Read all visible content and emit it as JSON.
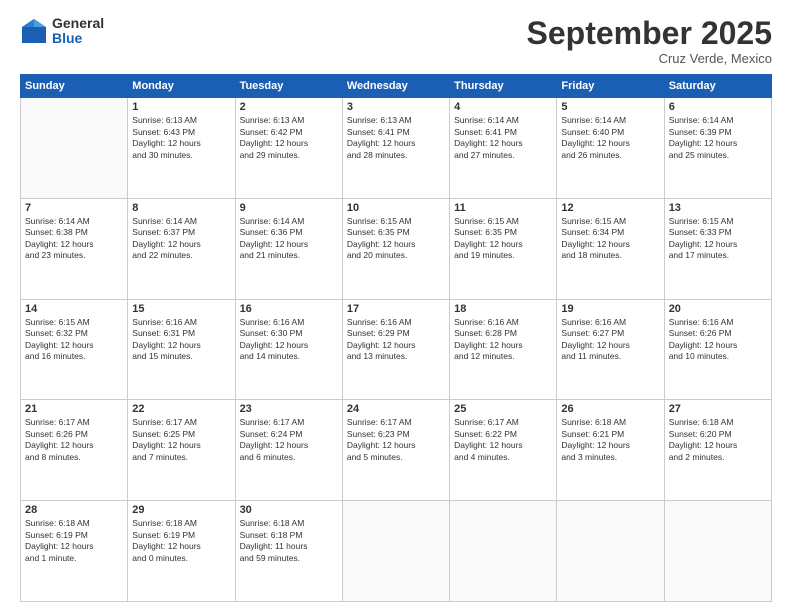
{
  "logo": {
    "general": "General",
    "blue": "Blue"
  },
  "header": {
    "month": "September 2025",
    "location": "Cruz Verde, Mexico"
  },
  "days_of_week": [
    "Sunday",
    "Monday",
    "Tuesday",
    "Wednesday",
    "Thursday",
    "Friday",
    "Saturday"
  ],
  "weeks": [
    [
      {
        "day": "",
        "info": ""
      },
      {
        "day": "1",
        "info": "Sunrise: 6:13 AM\nSunset: 6:43 PM\nDaylight: 12 hours\nand 30 minutes."
      },
      {
        "day": "2",
        "info": "Sunrise: 6:13 AM\nSunset: 6:42 PM\nDaylight: 12 hours\nand 29 minutes."
      },
      {
        "day": "3",
        "info": "Sunrise: 6:13 AM\nSunset: 6:41 PM\nDaylight: 12 hours\nand 28 minutes."
      },
      {
        "day": "4",
        "info": "Sunrise: 6:14 AM\nSunset: 6:41 PM\nDaylight: 12 hours\nand 27 minutes."
      },
      {
        "day": "5",
        "info": "Sunrise: 6:14 AM\nSunset: 6:40 PM\nDaylight: 12 hours\nand 26 minutes."
      },
      {
        "day": "6",
        "info": "Sunrise: 6:14 AM\nSunset: 6:39 PM\nDaylight: 12 hours\nand 25 minutes."
      }
    ],
    [
      {
        "day": "7",
        "info": "Sunrise: 6:14 AM\nSunset: 6:38 PM\nDaylight: 12 hours\nand 23 minutes."
      },
      {
        "day": "8",
        "info": "Sunrise: 6:14 AM\nSunset: 6:37 PM\nDaylight: 12 hours\nand 22 minutes."
      },
      {
        "day": "9",
        "info": "Sunrise: 6:14 AM\nSunset: 6:36 PM\nDaylight: 12 hours\nand 21 minutes."
      },
      {
        "day": "10",
        "info": "Sunrise: 6:15 AM\nSunset: 6:35 PM\nDaylight: 12 hours\nand 20 minutes."
      },
      {
        "day": "11",
        "info": "Sunrise: 6:15 AM\nSunset: 6:35 PM\nDaylight: 12 hours\nand 19 minutes."
      },
      {
        "day": "12",
        "info": "Sunrise: 6:15 AM\nSunset: 6:34 PM\nDaylight: 12 hours\nand 18 minutes."
      },
      {
        "day": "13",
        "info": "Sunrise: 6:15 AM\nSunset: 6:33 PM\nDaylight: 12 hours\nand 17 minutes."
      }
    ],
    [
      {
        "day": "14",
        "info": "Sunrise: 6:15 AM\nSunset: 6:32 PM\nDaylight: 12 hours\nand 16 minutes."
      },
      {
        "day": "15",
        "info": "Sunrise: 6:16 AM\nSunset: 6:31 PM\nDaylight: 12 hours\nand 15 minutes."
      },
      {
        "day": "16",
        "info": "Sunrise: 6:16 AM\nSunset: 6:30 PM\nDaylight: 12 hours\nand 14 minutes."
      },
      {
        "day": "17",
        "info": "Sunrise: 6:16 AM\nSunset: 6:29 PM\nDaylight: 12 hours\nand 13 minutes."
      },
      {
        "day": "18",
        "info": "Sunrise: 6:16 AM\nSunset: 6:28 PM\nDaylight: 12 hours\nand 12 minutes."
      },
      {
        "day": "19",
        "info": "Sunrise: 6:16 AM\nSunset: 6:27 PM\nDaylight: 12 hours\nand 11 minutes."
      },
      {
        "day": "20",
        "info": "Sunrise: 6:16 AM\nSunset: 6:26 PM\nDaylight: 12 hours\nand 10 minutes."
      }
    ],
    [
      {
        "day": "21",
        "info": "Sunrise: 6:17 AM\nSunset: 6:26 PM\nDaylight: 12 hours\nand 8 minutes."
      },
      {
        "day": "22",
        "info": "Sunrise: 6:17 AM\nSunset: 6:25 PM\nDaylight: 12 hours\nand 7 minutes."
      },
      {
        "day": "23",
        "info": "Sunrise: 6:17 AM\nSunset: 6:24 PM\nDaylight: 12 hours\nand 6 minutes."
      },
      {
        "day": "24",
        "info": "Sunrise: 6:17 AM\nSunset: 6:23 PM\nDaylight: 12 hours\nand 5 minutes."
      },
      {
        "day": "25",
        "info": "Sunrise: 6:17 AM\nSunset: 6:22 PM\nDaylight: 12 hours\nand 4 minutes."
      },
      {
        "day": "26",
        "info": "Sunrise: 6:18 AM\nSunset: 6:21 PM\nDaylight: 12 hours\nand 3 minutes."
      },
      {
        "day": "27",
        "info": "Sunrise: 6:18 AM\nSunset: 6:20 PM\nDaylight: 12 hours\nand 2 minutes."
      }
    ],
    [
      {
        "day": "28",
        "info": "Sunrise: 6:18 AM\nSunset: 6:19 PM\nDaylight: 12 hours\nand 1 minute."
      },
      {
        "day": "29",
        "info": "Sunrise: 6:18 AM\nSunset: 6:19 PM\nDaylight: 12 hours\nand 0 minutes."
      },
      {
        "day": "30",
        "info": "Sunrise: 6:18 AM\nSunset: 6:18 PM\nDaylight: 11 hours\nand 59 minutes."
      },
      {
        "day": "",
        "info": ""
      },
      {
        "day": "",
        "info": ""
      },
      {
        "day": "",
        "info": ""
      },
      {
        "day": "",
        "info": ""
      }
    ]
  ]
}
